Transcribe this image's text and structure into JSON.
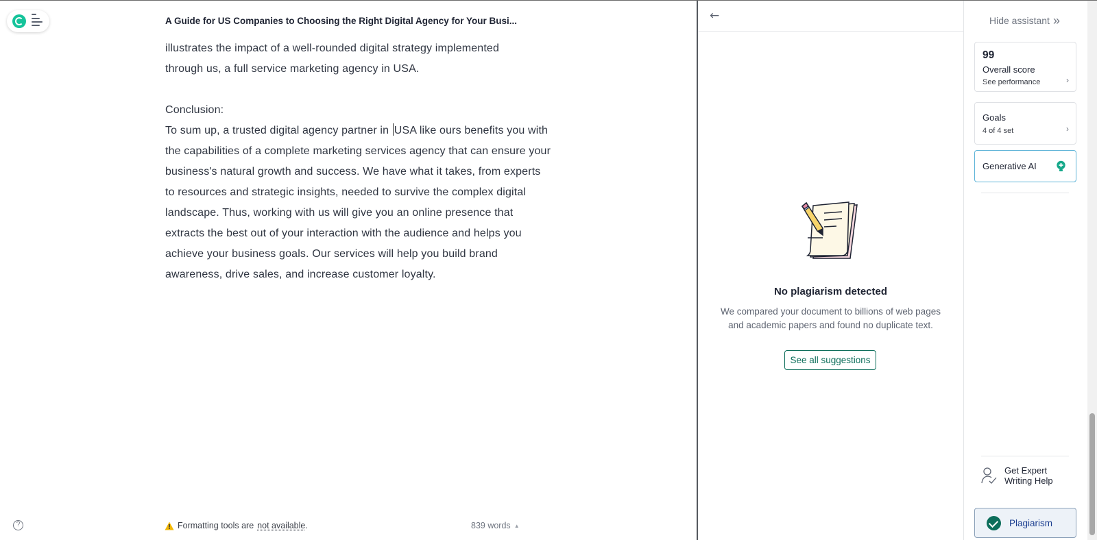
{
  "editor": {
    "title": "A Guide for US Companies to Choosing the Right Digital Agency for Your Busi...",
    "paragraph_1_line_1": "illustrates the impact of a well-rounded digital strategy implemented",
    "paragraph_1_line_2": "through us, a full service marketing agency in USA.",
    "conclusion_heading": "Conclusion:",
    "conclusion_before_caret": "To sum up, a trusted digital agency partner in ",
    "conclusion_after_caret": "USA like ours benefits you with the capabilities of a complete marketing services agency that can ensure your business's natural growth and success. We have what it takes, from experts to resources and strategic insights, needed to survive the complex digital landscape. Thus, working with us will give you an online presence that extracts the best out of your interaction with the audience and helps you achieve your business goals. Our services will help you build brand awareness, drive sales, and increase customer loyalty.",
    "format_notice_prefix": "Formatting tools are",
    "format_notice_link": "not available",
    "format_notice_suffix": ".",
    "word_count": "839 words",
    "word_count_caret": "▲",
    "help_glyph": "?"
  },
  "panel": {
    "back_glyph": "←",
    "status_title": "No plagiarism detected",
    "status_description": "We compared your document to billions of web pages and academic papers and found no duplicate text.",
    "see_all_label": "See all suggestions"
  },
  "sidebar": {
    "hide_assistant_label": "Hide assistant",
    "hide_assistant_glyph": "»",
    "overall_score_value": "99",
    "overall_score_label": "Overall score",
    "overall_score_link": "See performance",
    "goals_label": "Goals",
    "goals_status": "4 of 4 set",
    "generative_ai_label": "Generative AI",
    "expert_help_line_1": "Get Expert",
    "expert_help_line_2": "Writing Help",
    "plagiarism_tab_label": "Plagiarism",
    "chevron_glyph": "›"
  },
  "colors": {
    "accent_green": "#0d6e5b",
    "grammarly_green": "#15c39a",
    "genai_border": "#5fb4d8",
    "plagiarism_tab_bg": "#edf2f8",
    "plagiarism_tab_text": "#1a3d8f",
    "warning_yellow": "#f2b705"
  },
  "icons": {
    "logo": "grammarly-logo-icon",
    "menu": "menu-lines-icon",
    "help": "help-circle-icon",
    "warning": "warning-triangle-icon",
    "back": "arrow-left-icon",
    "illustration": "pencil-paper-illustration",
    "hide": "double-chevron-right-icon",
    "chevron": "chevron-right-icon",
    "genai": "lightbulb-plus-icon",
    "expert": "person-check-icon",
    "plagiarism": "check-circle-icon"
  }
}
